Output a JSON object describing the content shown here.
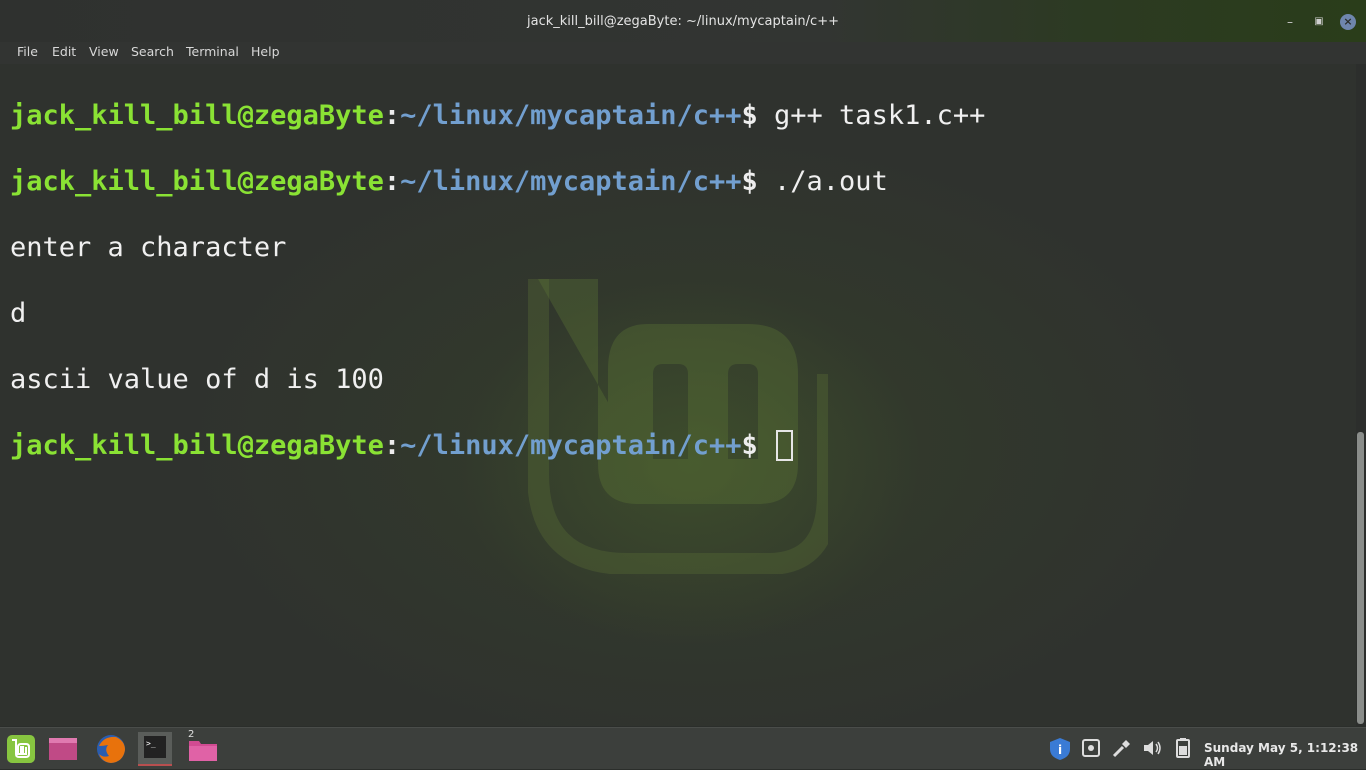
{
  "window": {
    "title": "jack_kill_bill@zegaByte: ~/linux/mycaptain/c++"
  },
  "menubar": {
    "items": [
      "File",
      "Edit",
      "View",
      "Search",
      "Terminal",
      "Help"
    ]
  },
  "terminal": {
    "prompt": {
      "user_host": "jack_kill_bill@zegaByte",
      "colon": ":",
      "path": "~/linux/mycaptain/c++",
      "dollar": "$ "
    },
    "lines": [
      {
        "type": "prompt",
        "command": "g++ task1.c++"
      },
      {
        "type": "prompt",
        "command": "./a.out"
      },
      {
        "type": "output",
        "text": "enter a character"
      },
      {
        "type": "output",
        "text": "d"
      },
      {
        "type": "output",
        "text": "ascii value of d is 100"
      },
      {
        "type": "prompt",
        "command": "",
        "cursor": true
      }
    ],
    "colors": {
      "user": "#8ae234",
      "path": "#729fcf",
      "text": "#f0f0f0"
    }
  },
  "taskbar": {
    "launchers": [
      {
        "name": "mint-menu-icon"
      },
      {
        "name": "show-desktop-icon"
      },
      {
        "name": "firefox-icon"
      },
      {
        "name": "terminal-icon",
        "active": true
      },
      {
        "name": "files-folder-icon",
        "badge": "2"
      }
    ],
    "tray": [
      "update-shield-icon",
      "tray-app-icon",
      "network-icon",
      "volume-icon",
      "battery-icon"
    ],
    "clock": "Sunday May  5, 1:12:38 AM"
  }
}
